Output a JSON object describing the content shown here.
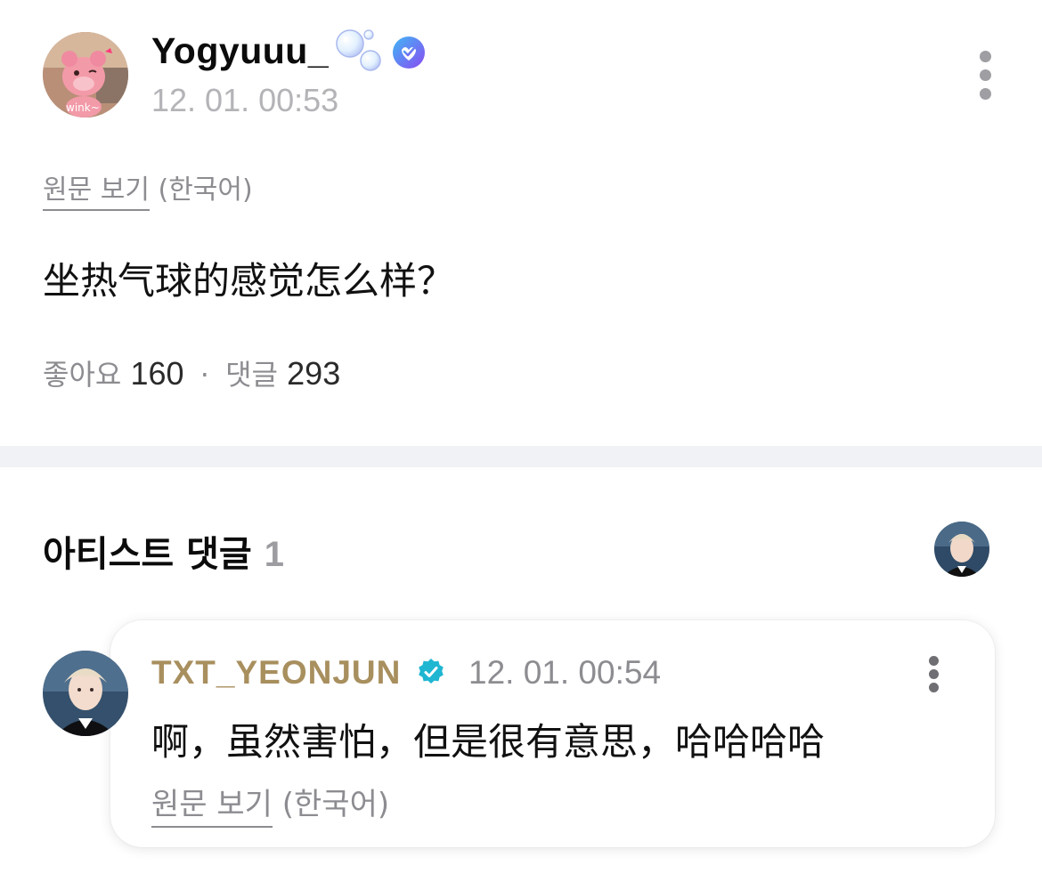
{
  "post": {
    "author": "Yogyuuu_",
    "avatar_caption": "wink~",
    "timestamp": "12. 01. 00:53",
    "view_original_label": "원문 보기",
    "original_language": "(한국어)",
    "body": "坐热气球的感觉怎么样？",
    "likes_label": "좋아요",
    "likes_count": "160",
    "separator": "·",
    "comments_label": "댓글",
    "comments_count": "293"
  },
  "artist_comments": {
    "heading": "아티스트 댓글",
    "count": "1",
    "items": [
      {
        "author": "TXT_YEONJUN",
        "timestamp": "12. 01. 00:54",
        "body": "啊，虽然害怕，但是很有意思，哈哈哈哈",
        "view_original_label": "원문 보기",
        "original_language": "(한국어)"
      }
    ]
  },
  "colors": {
    "artist_name": "#a88f5e",
    "verified_teal": "#1fb6d2",
    "verified_purple": "#6f5cf0",
    "muted_text": "#8c8c91",
    "divider": "#f1f2f6"
  },
  "icons": {
    "more": "vertical-ellipsis-icon",
    "verified_user": "verified-badge-icon",
    "verified_artist": "verified-check-badge-icon",
    "decoration": "bubbles-icon"
  }
}
